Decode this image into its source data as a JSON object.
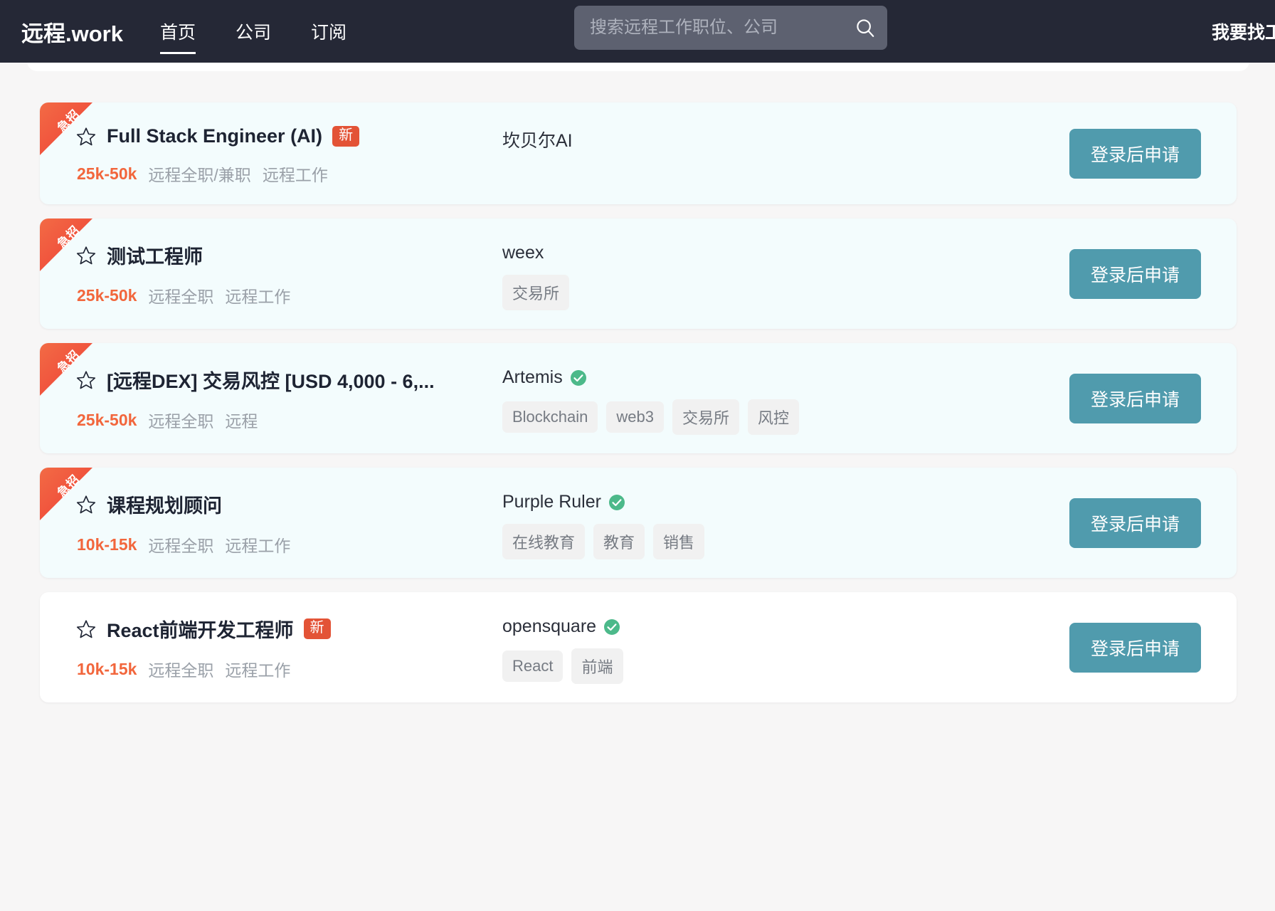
{
  "header": {
    "brand": "远程.work",
    "nav": [
      {
        "label": "首页",
        "active": true
      },
      {
        "label": "公司",
        "active": false
      },
      {
        "label": "订阅",
        "active": false
      }
    ],
    "search": {
      "placeholder": "搜索远程工作职位、公司",
      "value": "",
      "icon": "search-icon"
    },
    "right_action": "我要找工作"
  },
  "jobs": [
    {
      "urgent_label": "急招",
      "urgent": true,
      "title": "Full Stack Engineer (AI)",
      "new_badge": "新",
      "salary": "25k-50k",
      "meta": [
        "远程全职/兼职",
        "远程工作"
      ],
      "company": "坎贝尔AI",
      "verified": false,
      "tags": [],
      "apply_label": "登录后申请"
    },
    {
      "urgent_label": "急招",
      "urgent": true,
      "title": "测试工程师",
      "new_badge": "",
      "salary": "25k-50k",
      "meta": [
        "远程全职",
        "远程工作"
      ],
      "company": "weex",
      "verified": false,
      "tags": [
        "交易所"
      ],
      "apply_label": "登录后申请"
    },
    {
      "urgent_label": "急招",
      "urgent": true,
      "title": "[远程DEX] 交易风控 [USD 4,000 - 6,...",
      "new_badge": "",
      "salary": "25k-50k",
      "meta": [
        "远程全职",
        "远程"
      ],
      "company": "Artemis",
      "verified": true,
      "tags": [
        "Blockchain",
        "web3",
        "交易所",
        "风控"
      ],
      "apply_label": "登录后申请"
    },
    {
      "urgent_label": "急招",
      "urgent": true,
      "title": "课程规划顾问",
      "new_badge": "",
      "salary": "10k-15k",
      "meta": [
        "远程全职",
        "远程工作"
      ],
      "company": "Purple Ruler",
      "verified": true,
      "tags": [
        "在线教育",
        "教育",
        "销售"
      ],
      "apply_label": "登录后申请"
    },
    {
      "urgent_label": "",
      "urgent": false,
      "title": "React前端开发工程师",
      "new_badge": "新",
      "salary": "10k-15k",
      "meta": [
        "远程全职",
        "远程工作"
      ],
      "company": "opensquare",
      "verified": true,
      "tags": [
        "React",
        "前端"
      ],
      "apply_label": "登录后申请"
    }
  ],
  "colors": {
    "navbar_bg": "#252836",
    "urgent_card_bg": "#f3fcfd",
    "ribbon_red": "#ef3e36",
    "salary_orange": "#f2663c",
    "new_badge_red": "#e35336",
    "apply_button_teal": "#509bad",
    "verified_green": "#4cb98a",
    "tag_bg": "#f1f1f1"
  }
}
